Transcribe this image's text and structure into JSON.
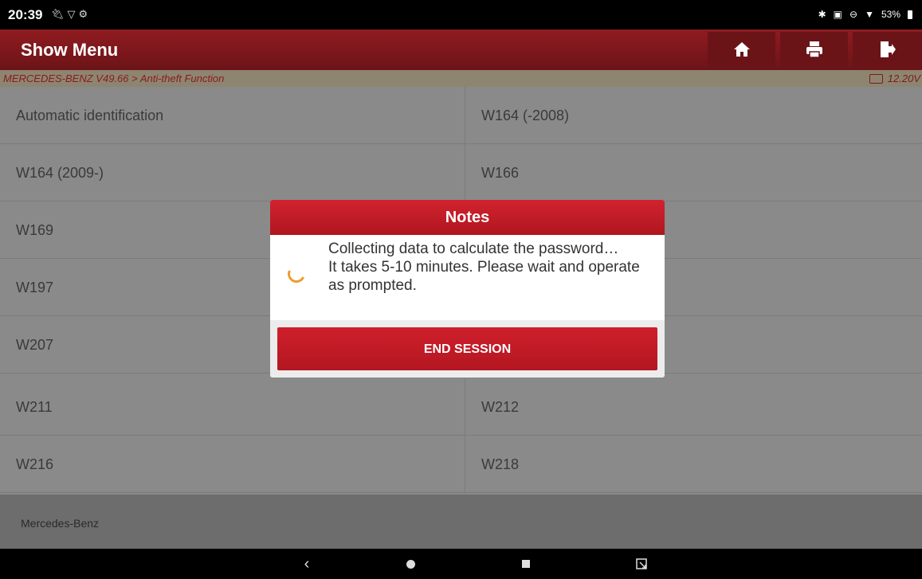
{
  "status_bar": {
    "time": "20:39",
    "left_icons": [
      "usb-icon",
      "wifi-icon",
      "settings-icon"
    ],
    "battery": "53%"
  },
  "header": {
    "title": "Show Menu",
    "buttons": [
      "home-icon",
      "print-icon",
      "exit-icon"
    ]
  },
  "breadcrumb": {
    "path": "MERCEDES-BENZ V49.66 > Anti-theft Function",
    "voltage": "12.20V"
  },
  "menu": {
    "items": [
      {
        "left": "Automatic identification",
        "right": "W164 (-2008)"
      },
      {
        "left": "W164 (2009-)",
        "right": "W166"
      },
      {
        "left": "W169",
        "right": ""
      },
      {
        "left": "W197",
        "right": ""
      },
      {
        "left": "W207",
        "right": ""
      },
      {
        "left": "W211",
        "right": "W212"
      },
      {
        "left": "W216",
        "right": "W218"
      }
    ]
  },
  "footer": {
    "label": "Mercedes-Benz"
  },
  "dialog": {
    "title": "Notes",
    "message": "Collecting data to calculate the password…\n It takes 5-10 minutes. Please wait and operate as prompted.",
    "button": "END SESSION"
  },
  "colors": {
    "header": "#7a161a",
    "dialog_accent": "#c41d28",
    "spinner": "#f09a2a"
  }
}
